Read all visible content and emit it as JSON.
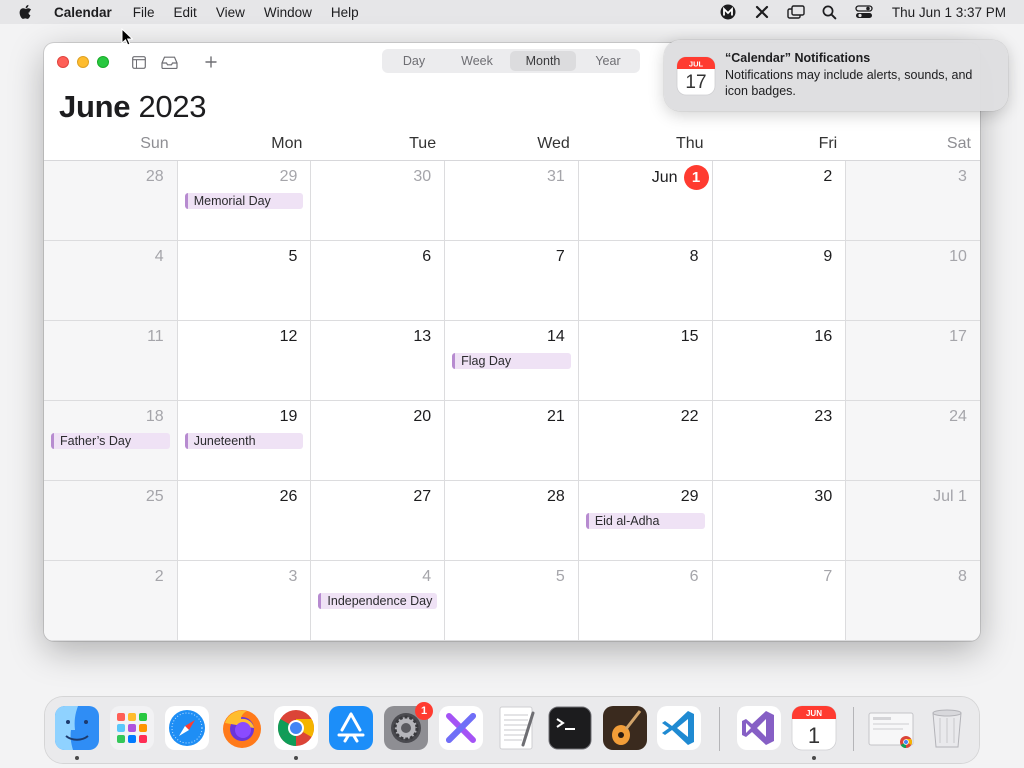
{
  "menubar": {
    "app_name": "Calendar",
    "items": [
      "File",
      "Edit",
      "View",
      "Window",
      "Help"
    ],
    "clock": "Thu Jun 1  3:37 PM"
  },
  "window": {
    "view_tabs": [
      "Day",
      "Week",
      "Month",
      "Year"
    ],
    "active_view": "Month",
    "month": "June",
    "year": "2023",
    "weekdays": [
      "Sun",
      "Mon",
      "Tue",
      "Wed",
      "Thu",
      "Fri",
      "Sat"
    ],
    "today_label": "Jun",
    "today_number": "1",
    "weeks": [
      [
        {
          "label": "28",
          "other": true,
          "weekend": true
        },
        {
          "label": "29",
          "other": true,
          "event": "Memorial Day"
        },
        {
          "label": "30",
          "other": true
        },
        {
          "label": "31",
          "other": true
        },
        {
          "label": "Jun 1",
          "today": true
        },
        {
          "label": "2"
        },
        {
          "label": "3",
          "other": true,
          "weekend": true
        }
      ],
      [
        {
          "label": "4",
          "other": true,
          "weekend": true
        },
        {
          "label": "5"
        },
        {
          "label": "6"
        },
        {
          "label": "7"
        },
        {
          "label": "8"
        },
        {
          "label": "9"
        },
        {
          "label": "10",
          "other": true,
          "weekend": true
        }
      ],
      [
        {
          "label": "11",
          "other": true,
          "weekend": true
        },
        {
          "label": "12"
        },
        {
          "label": "13"
        },
        {
          "label": "14",
          "event": "Flag Day"
        },
        {
          "label": "15"
        },
        {
          "label": "16"
        },
        {
          "label": "17",
          "other": true,
          "weekend": true
        }
      ],
      [
        {
          "label": "18",
          "other": true,
          "weekend": true,
          "event": "Father’s Day"
        },
        {
          "label": "19",
          "event": "Juneteenth"
        },
        {
          "label": "20"
        },
        {
          "label": "21"
        },
        {
          "label": "22"
        },
        {
          "label": "23"
        },
        {
          "label": "24",
          "other": true,
          "weekend": true
        }
      ],
      [
        {
          "label": "25",
          "other": true,
          "weekend": true
        },
        {
          "label": "26"
        },
        {
          "label": "27"
        },
        {
          "label": "28"
        },
        {
          "label": "29",
          "event": "Eid al-Adha"
        },
        {
          "label": "30"
        },
        {
          "label": "Jul 1",
          "other": true,
          "weekend": true
        }
      ],
      [
        {
          "label": "2",
          "other": true,
          "weekend": true
        },
        {
          "label": "3",
          "other": true
        },
        {
          "label": "4",
          "other": true,
          "event": "Independence Day"
        },
        {
          "label": "5",
          "other": true
        },
        {
          "label": "6",
          "other": true
        },
        {
          "label": "7",
          "other": true
        },
        {
          "label": "8",
          "other": true,
          "weekend": true
        }
      ]
    ]
  },
  "notification": {
    "title": "“Calendar” Notifications",
    "body": "Notifications may include alerts, sounds, and icon badges.",
    "icon_month": "JUL",
    "icon_day": "17"
  },
  "dock": {
    "apps": [
      "Finder",
      "Launchpad",
      "Safari",
      "Firefox",
      "Chrome",
      "App Store",
      "System Settings",
      "Xcode-like",
      "TextEdit",
      "Terminal",
      "GarageBand",
      "VS Code",
      "Visual Studio",
      "Calendar",
      "Downloads",
      "Trash"
    ],
    "settings_badge": "1",
    "calendar_icon_month": "JUN",
    "calendar_icon_day": "1"
  },
  "colors": {
    "today_red": "#ff3b30",
    "event_fill": "#efe2f5",
    "event_bar": "#b78bd0"
  }
}
